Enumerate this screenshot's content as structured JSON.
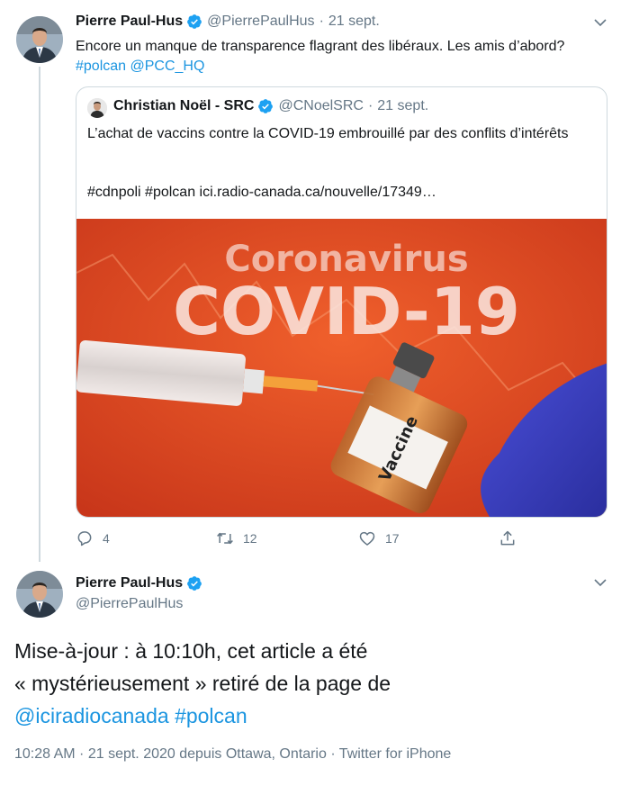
{
  "tweet1": {
    "author_name": "Pierre Paul-Hus",
    "handle": "@PierrePaulHus",
    "date": "21 sept.",
    "text_plain": "Encore un manque de transparence flagrant des libéraux. Les amis d’abord? ",
    "hashtag_polcan": "#polcan",
    "mention_pcc": "@PCC_HQ",
    "actions": {
      "reply_count": "4",
      "retweet_count": "12",
      "like_count": "17"
    }
  },
  "quoted_tweet": {
    "author_name": "Christian Noël - SRC",
    "handle": "@CNoelSRC",
    "date": "21 sept.",
    "text": "L’achat de vaccins contre la COVID-19 embrouillé par des conflits d’intérêts",
    "tags_line": "#cdnpoli #polcan  ici.radio-canada.ca/nouvelle/17349…",
    "image": {
      "headline_small": "Coronavirus",
      "headline_big": "COVID-19",
      "vial_label": "Vaccine"
    }
  },
  "tweet2": {
    "author_name": "Pierre Paul-Hus",
    "handle": "@PierrePaulHus",
    "text_line1": "Mise-à-jour : à 10:10h, cet article a été",
    "text_line2": "« mystérieusement » retiré de la page de",
    "mention": "@iciradiocanada",
    "hashtag": "#polcan",
    "meta": "10:28 AM · 21 sept. 2020 depuis Ottawa, Ontario · Twitter for iPhone"
  },
  "colors": {
    "link": "#1b95e0",
    "verified": "#1da1f2",
    "muted": "#657786",
    "border": "#cfd9de",
    "image_bg": "#e2421f"
  },
  "icons": [
    "verified-badge-icon",
    "chevron-down-icon",
    "reply-icon",
    "retweet-icon",
    "like-icon",
    "share-icon"
  ]
}
